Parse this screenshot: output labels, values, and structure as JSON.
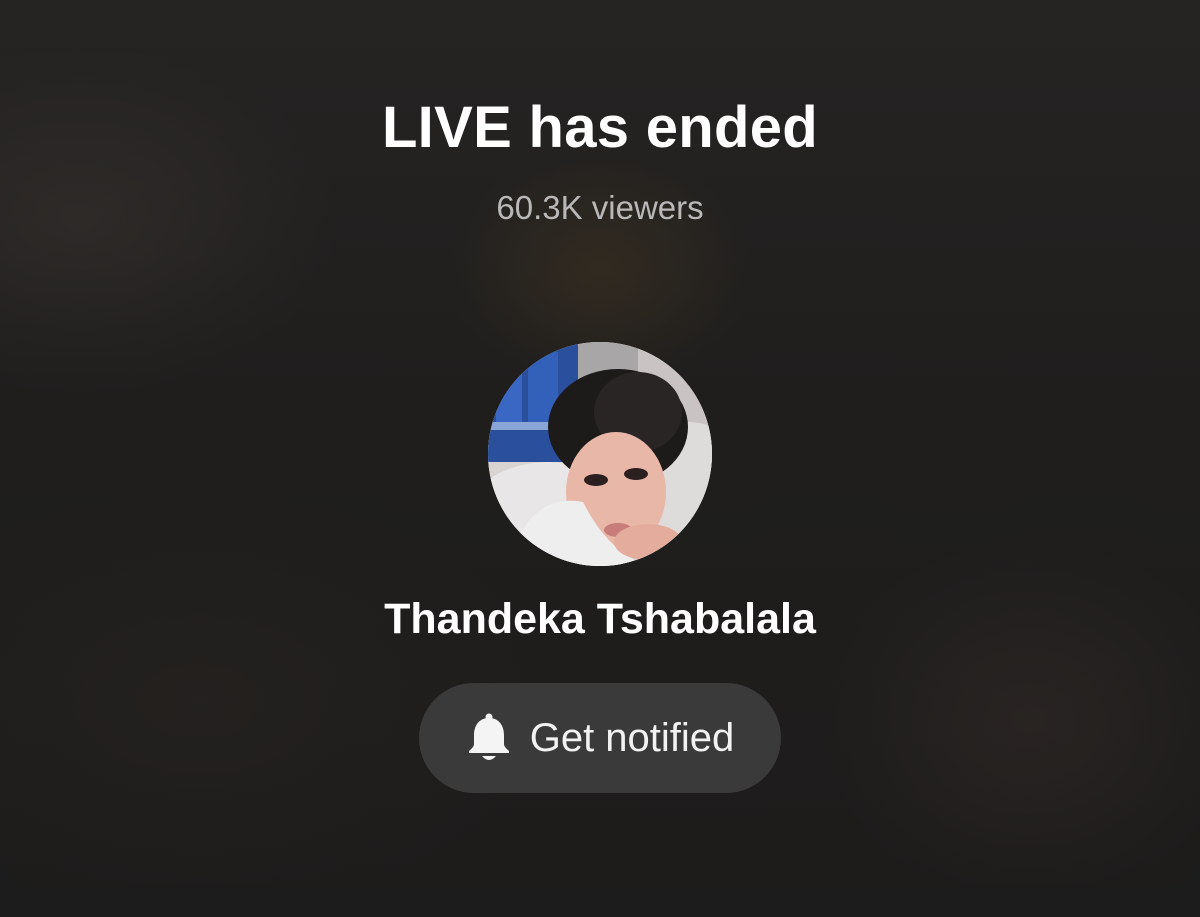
{
  "live_ended": {
    "title": "LIVE has ended",
    "viewers": "60.3K viewers"
  },
  "host": {
    "name": "Thandeka Tshabalala",
    "avatar_icon": "profile-photo"
  },
  "actions": {
    "notify_label": "Get notified",
    "notify_icon": "bell-icon"
  },
  "colors": {
    "background": "#1c1c1c",
    "title": "#ffffff",
    "viewers": "#b9b9b9",
    "button_bg": "#3b3a3a"
  }
}
